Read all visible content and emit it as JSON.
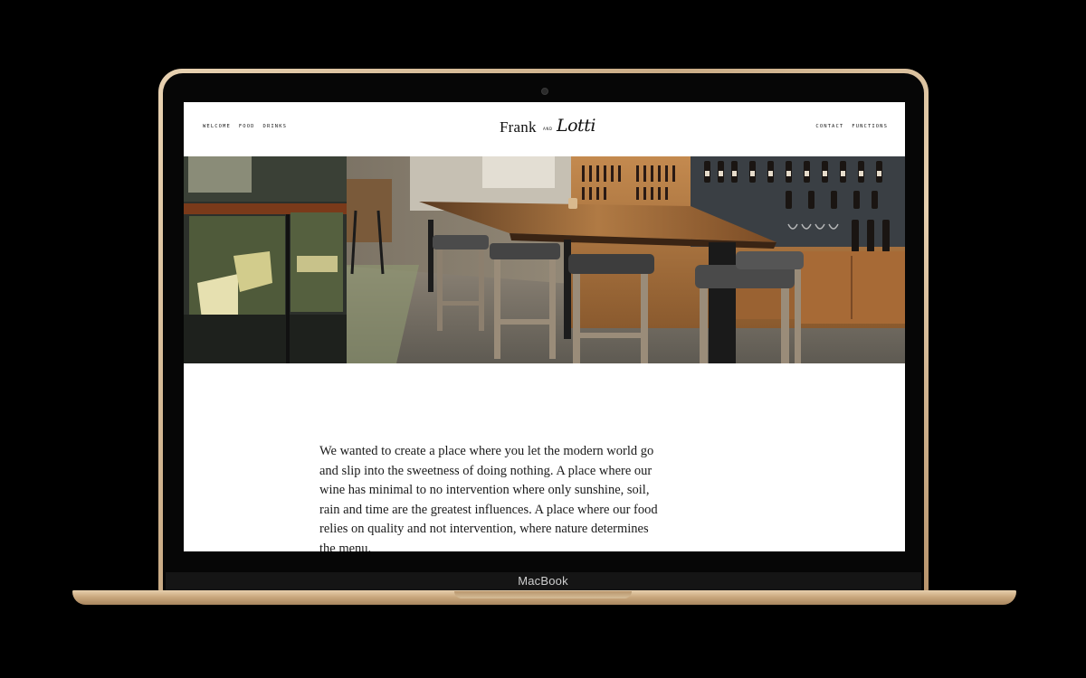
{
  "device": {
    "label": "MacBook"
  },
  "site": {
    "logo": {
      "part1": "Frank",
      "connector": "AND",
      "part2": "Lotti"
    },
    "nav_left": [
      "WELCOME",
      "FOOD",
      "DRINKS"
    ],
    "nav_right": [
      "CONTACT",
      "FUNCTIONS"
    ],
    "hero_image": "restaurant-interior-photo",
    "intro_text": "We wanted to create a place where you let the modern world go and slip into the sweetness of doing nothing. A place where our wine has minimal to no intervention where only sunshine, soil, rain and time are the greatest influences. A place where our food relies on quality and not intervention, where nature determines the menu."
  },
  "colors": {
    "body_bg": "#000000",
    "screen_bg": "#ffffff",
    "laptop_gold": "#d9bf9a",
    "text": "#1a1a1a"
  }
}
